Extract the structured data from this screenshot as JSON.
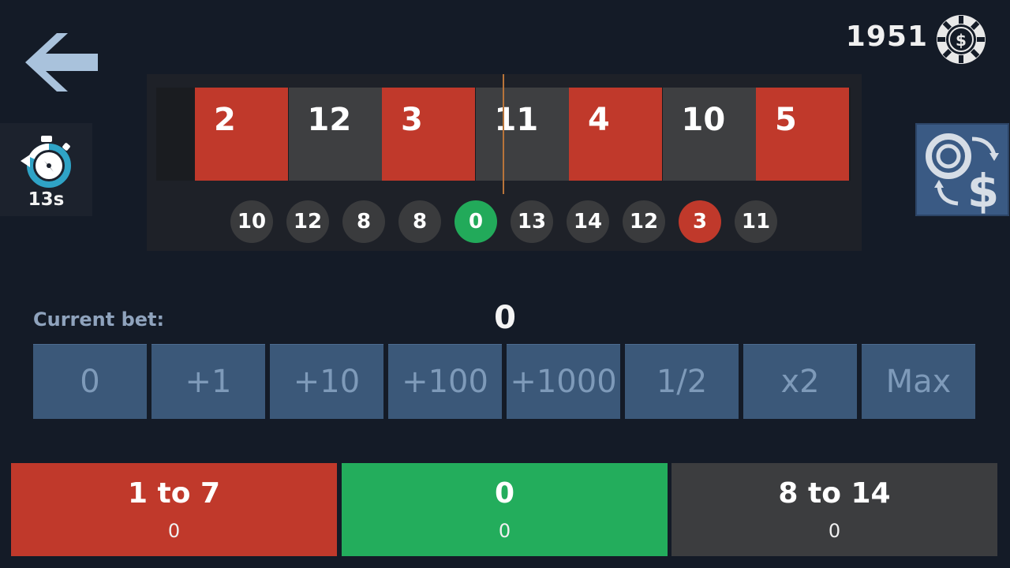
{
  "balance": "1951",
  "timer": "13s",
  "wheel": [
    {
      "value": "2",
      "color": "red"
    },
    {
      "value": "12",
      "color": "dark"
    },
    {
      "value": "3",
      "color": "red"
    },
    {
      "value": "11",
      "color": "dark"
    },
    {
      "value": "4",
      "color": "red"
    },
    {
      "value": "10",
      "color": "dark"
    },
    {
      "value": "5",
      "color": "red"
    }
  ],
  "history": [
    {
      "value": "10",
      "color": "dark"
    },
    {
      "value": "12",
      "color": "dark"
    },
    {
      "value": "8",
      "color": "dark"
    },
    {
      "value": "8",
      "color": "dark"
    },
    {
      "value": "0",
      "color": "green"
    },
    {
      "value": "13",
      "color": "dark"
    },
    {
      "value": "14",
      "color": "dark"
    },
    {
      "value": "12",
      "color": "dark"
    },
    {
      "value": "3",
      "color": "red"
    },
    {
      "value": "11",
      "color": "dark"
    }
  ],
  "current_bet": {
    "label": "Current bet:",
    "value": "0"
  },
  "bet_buttons": [
    "0",
    "+1",
    "+10",
    "+100",
    "+1000",
    "1/2",
    "x2",
    "Max"
  ],
  "color_bets": {
    "red": {
      "label": "1 to 7",
      "amount": "0"
    },
    "green": {
      "label": "0",
      "amount": "0"
    },
    "black": {
      "label": "8 to 14",
      "amount": "0"
    }
  },
  "colors": {
    "red": "#c0392b",
    "green": "#23ad5c",
    "dark": "#3e3f41",
    "background": "#141b27",
    "button": "#3b5879"
  },
  "icons": [
    "back-arrow-icon",
    "chip-icon",
    "stopwatch-icon",
    "exchange-icon"
  ]
}
